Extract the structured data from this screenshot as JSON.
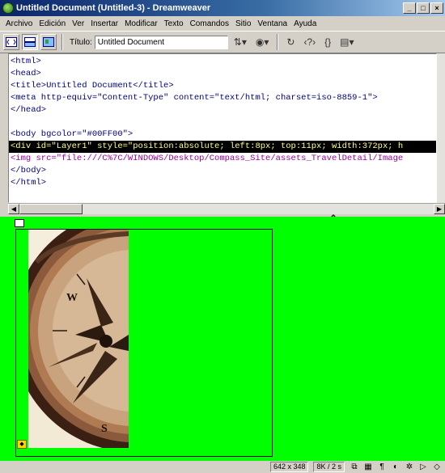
{
  "window": {
    "title": "Untitled Document (Untitled-3) - Dreamweaver",
    "minimize_icon": "minimize-icon",
    "maximize_icon": "maximize-icon",
    "close_icon": "close-icon"
  },
  "menubar": {
    "items": [
      "Archivo",
      "Edición",
      "Ver",
      "Insertar",
      "Modificar",
      "Texto",
      "Comandos",
      "Sitio",
      "Ventana",
      "Ayuda"
    ]
  },
  "toolbar": {
    "title_label": "Título:",
    "title_value": "Untitled Document",
    "view_buttons": [
      "code-view-icon",
      "code-and-design-view-icon",
      "design-view-icon"
    ],
    "tool_icons": [
      "file-management-icon",
      "preview-in-browser-icon",
      "refresh-icon",
      "reference-icon",
      "code-navigation-icon",
      "view-options-icon"
    ]
  },
  "code": {
    "lines": [
      "<html>",
      "<head>",
      "<title>Untitled Document</title>",
      "<meta http-equiv=\"Content-Type\" content=\"text/html; charset=iso-8859-1\">",
      "</head>",
      "",
      "<body bgcolor=\"#00FF00\">",
      "<div id=\"Layer1\" style=\"position:absolute; left:8px; top:11px; width:372px; h",
      "<img src=\"file:///C%7C/WINDOWS/Desktop/Compass_Site/assets_TravelDetail/Image",
      "</body>",
      "</html>"
    ],
    "selected_line_index": 7
  },
  "design": {
    "background_color": "#00FF00",
    "image": "compass-image"
  },
  "statusbar": {
    "window_size": "642 x 348",
    "download_size": "8K / 2 s",
    "launcher_icons": [
      "site-icon",
      "assets-icon",
      "html-styles-icon",
      "css-styles-icon",
      "behaviors-icon",
      "timelines-icon",
      "code-inspector-icon"
    ]
  },
  "colors": {
    "title_bar_start": "#0a246a",
    "title_bar_end": "#a6caf0",
    "design_bg": "#00ff00",
    "selected_line_bg": "#000000",
    "selected_line_text": "#ffff80",
    "tag_color": "#000080",
    "img_tag_color": "#990099"
  }
}
